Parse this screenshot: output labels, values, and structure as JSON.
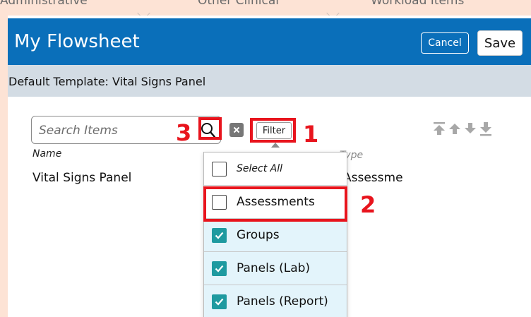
{
  "background_tabs": [
    "Administrative",
    "Other Clinical",
    "Workload Items"
  ],
  "window": {
    "title": "My Flowsheet",
    "cancel_label": "Cancel",
    "save_label": "Save"
  },
  "template": {
    "label": "Default Template: Vital Signs Panel"
  },
  "search": {
    "placeholder": "Search Items",
    "icon": "search-icon"
  },
  "filter": {
    "label": "Filter"
  },
  "columns": {
    "name": "Name",
    "type": "Type"
  },
  "rows": [
    {
      "name": "Vital Signs Panel",
      "type": "Assessment"
    }
  ],
  "filter_menu": {
    "select_all": {
      "label": "Select All",
      "checked": false
    },
    "items": [
      {
        "label": "Assessments",
        "checked": false
      },
      {
        "label": "Groups",
        "checked": true
      },
      {
        "label": "Panels (Lab)",
        "checked": true
      },
      {
        "label": "Panels (Report)",
        "checked": true
      }
    ]
  },
  "annotations": [
    {
      "number": "1"
    },
    {
      "number": "2"
    },
    {
      "number": "3"
    }
  ],
  "colors": {
    "header": "#0a6fba",
    "template_bar": "#d3dce4",
    "checkbox_on": "#1e9aa0",
    "highlight": "#e8141d",
    "backdrop": "#fde3d5"
  }
}
